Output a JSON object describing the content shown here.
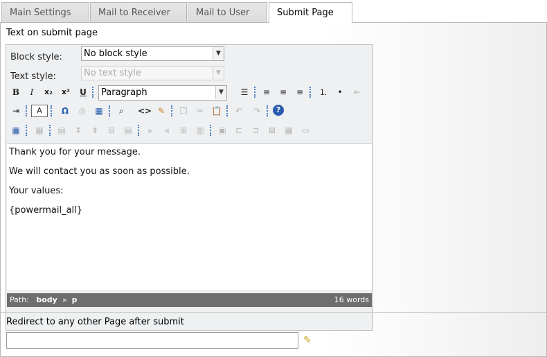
{
  "tabs": [
    "Main Settings",
    "Mail to Receiver",
    "Mail to User",
    "Submit Page"
  ],
  "active_tab": "Submit Page",
  "section_label": "Text on submit page",
  "block_style": {
    "label": "Block style:",
    "value": "No block style"
  },
  "text_style": {
    "label": "Text style:",
    "value": "No text style"
  },
  "paragraph_format": "Paragraph",
  "editor": {
    "paragraphs": [
      "Thank you for your message.",
      "We will contact you as soon as possible.",
      "Your values:",
      "{powermail_all}"
    ]
  },
  "statusbar": {
    "path_label": "Path:",
    "path_body": "body",
    "path_sep": "»",
    "path_p": "p",
    "word_count": "16 words"
  },
  "redirect": {
    "label": "Redirect to any other Page after submit",
    "value": ""
  },
  "toolbar_icons_row1": [
    "bold-icon",
    "italic-icon",
    "subscript-icon",
    "superscript-icon",
    "underline-icon",
    "list-style-icon",
    "align-left-icon",
    "align-center-icon",
    "align-right-icon",
    "ordered-list-icon",
    "unordered-list-icon",
    "outdent-icon"
  ],
  "toolbar_icons_row2": [
    "indent-icon",
    "text-color-icon",
    "special-char-icon",
    "insert-link-icon",
    "insert-table-icon",
    "find-replace-icon",
    "html-source-icon",
    "clean-icon",
    "copy-icon",
    "cut-icon",
    "paste-icon",
    "undo-icon",
    "redo-icon",
    "help-icon"
  ]
}
